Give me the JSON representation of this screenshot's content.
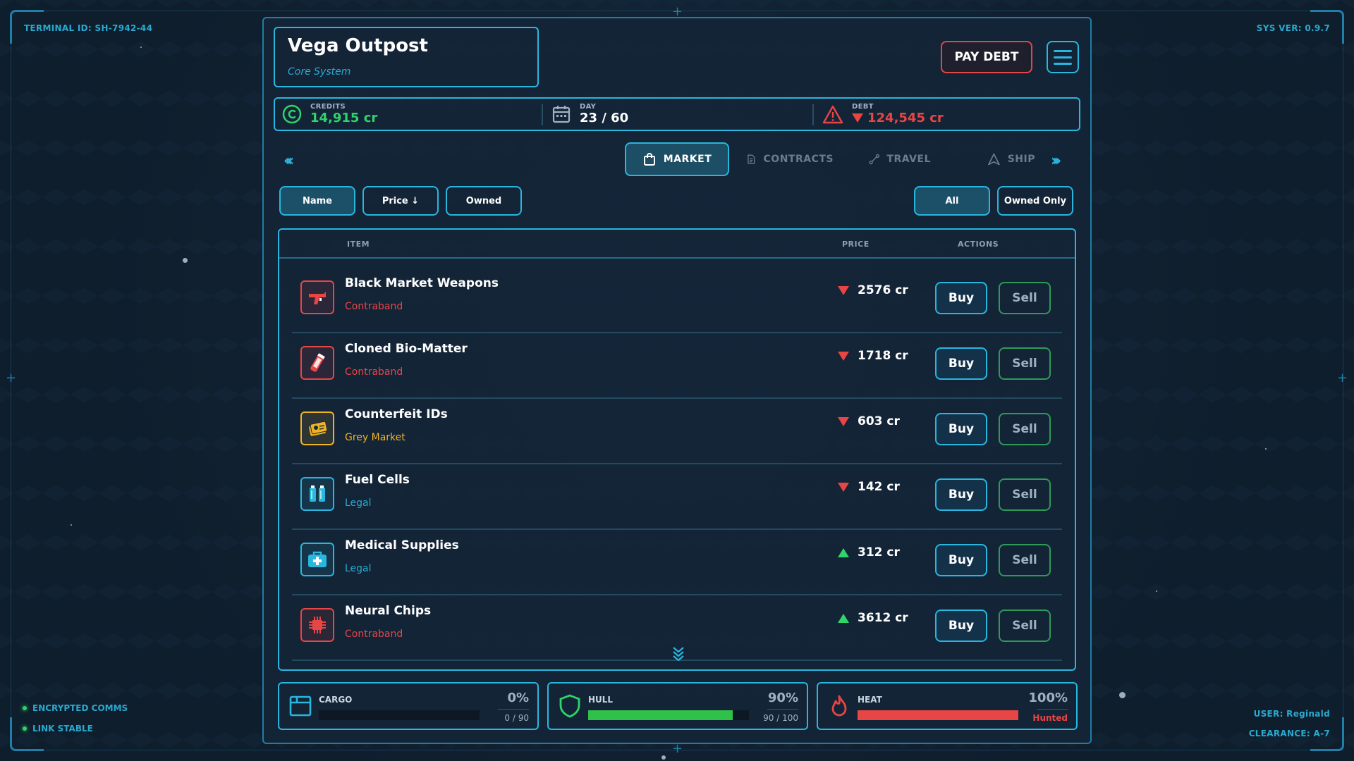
{
  "screen": {
    "terminal_id": "TERMINAL ID: SH-7942-44",
    "sys_ver": "SYS VER: 0.9.7",
    "status": [
      "ENCRYPTED COMMS",
      "LINK STABLE"
    ],
    "user": "USER: Reginald",
    "clearance": "CLEARANCE: A-7"
  },
  "station": {
    "name": "Vega Outpost",
    "system": "Core System"
  },
  "header": {
    "pay_debt": "PAY DEBT",
    "menu_icon": "hamburger-menu-icon"
  },
  "stats": {
    "credits_label": "CREDITS",
    "credits_value": "14,915 cr",
    "day_label": "DAY",
    "day_value": "23 / 60",
    "debt_label": "DEBT",
    "debt_value": "124,545 cr"
  },
  "tabs": [
    {
      "label": "MARKET",
      "active": true
    },
    {
      "label": "CONTRACTS",
      "active": false
    },
    {
      "label": "TRAVEL",
      "active": false
    },
    {
      "label": "SHIP",
      "active": false
    }
  ],
  "sort": {
    "name": "Name",
    "price": "Price ↓",
    "owned": "Owned"
  },
  "filter": {
    "all": "All",
    "owned_only": "Owned Only"
  },
  "table": {
    "col_item": "ITEM",
    "col_price": "PRICE",
    "col_actions": "ACTIONS",
    "buy_label": "Buy",
    "sell_label": "Sell",
    "rows": [
      {
        "name": "Black Market Weapons",
        "tag": "Contraband",
        "price": "2576 cr",
        "trend": "down",
        "icon": "blaster-icon"
      },
      {
        "name": "Cloned Bio-Matter",
        "tag": "Contraband",
        "price": "1718 cr",
        "trend": "down",
        "icon": "vial-icon"
      },
      {
        "name": "Counterfeit IDs",
        "tag": "Grey Market",
        "price": "603 cr",
        "trend": "down",
        "icon": "id-cards-icon"
      },
      {
        "name": "Fuel Cells",
        "tag": "Legal",
        "price": "142 cr",
        "trend": "down",
        "icon": "fuel-cells-icon"
      },
      {
        "name": "Medical Supplies",
        "tag": "Legal",
        "price": "312 cr",
        "trend": "up",
        "icon": "medkit-icon"
      },
      {
        "name": "Neural Chips",
        "tag": "Contraband",
        "price": "3612 cr",
        "trend": "up",
        "icon": "chip-icon"
      }
    ]
  },
  "gauges": {
    "cargo": {
      "label": "CARGO",
      "pct": "0%",
      "sub": "0 / 90",
      "level": 0
    },
    "hull": {
      "label": "HULL",
      "pct": "90%",
      "sub": "90 / 100",
      "level": 0.9
    },
    "heat": {
      "label": "HEAT",
      "pct": "100%",
      "sub": "Hunted",
      "level": 1.0
    }
  },
  "colors": {
    "accent": "#29b6df",
    "legal": "#2aa9cf",
    "contraband": "#e84545",
    "grey_market": "#f0b323",
    "positive": "#2fd46b",
    "negative": "#e84545"
  }
}
